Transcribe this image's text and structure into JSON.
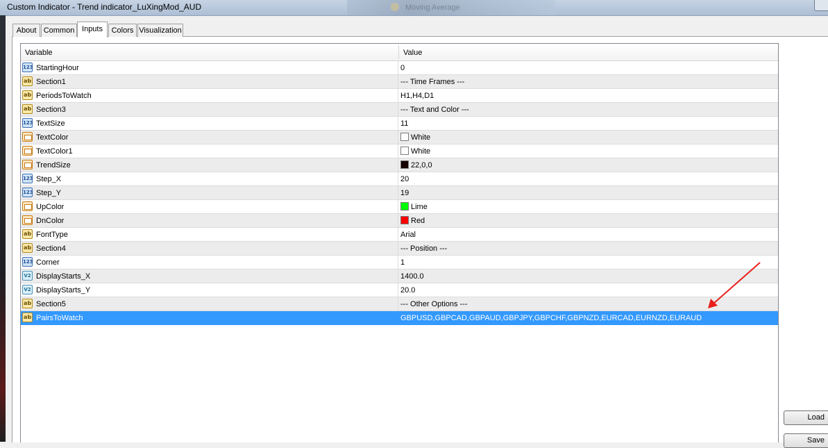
{
  "window": {
    "title": "Custom Indicator - Trend indicator_LuXingMod_AUD",
    "background_title": "Moving Average"
  },
  "tabs": [
    {
      "label": "About"
    },
    {
      "label": "Common"
    },
    {
      "label": "Inputs",
      "active": true
    },
    {
      "label": "Colors"
    },
    {
      "label": "Visualization"
    }
  ],
  "grid": {
    "header": {
      "variable": "Variable",
      "value": "Value"
    },
    "rows": [
      {
        "type": "int",
        "icon": "integer-icon",
        "name": "StartingHour",
        "value": "0"
      },
      {
        "type": "str",
        "icon": "string-icon",
        "name": "Section1",
        "value": "--- Time Frames ---"
      },
      {
        "type": "str",
        "icon": "string-icon",
        "name": "PeriodsToWatch",
        "value": "H1,H4,D1"
      },
      {
        "type": "str",
        "icon": "string-icon",
        "name": "Section3",
        "value": "--- Text and Color ---"
      },
      {
        "type": "int",
        "icon": "integer-icon",
        "name": "TextSize",
        "value": "11"
      },
      {
        "type": "col",
        "icon": "color-icon",
        "name": "TextColor",
        "value": "White",
        "swatch": "#ffffff"
      },
      {
        "type": "col",
        "icon": "color-icon",
        "name": "TextColor1",
        "value": "White",
        "swatch": "#ffffff"
      },
      {
        "type": "col",
        "icon": "color-icon",
        "name": "TrendSize",
        "value": "22,0,0",
        "swatch": "#160000"
      },
      {
        "type": "int",
        "icon": "integer-icon",
        "name": "Step_X",
        "value": "20"
      },
      {
        "type": "int",
        "icon": "integer-icon",
        "name": "Step_Y",
        "value": "19"
      },
      {
        "type": "col",
        "icon": "color-icon",
        "name": "UpColor",
        "value": "Lime",
        "swatch": "#00ff00"
      },
      {
        "type": "col",
        "icon": "color-icon",
        "name": "DnColor",
        "value": "Red",
        "swatch": "#ff0000"
      },
      {
        "type": "str",
        "icon": "string-icon",
        "name": "FontType",
        "value": "Arial"
      },
      {
        "type": "str",
        "icon": "string-icon",
        "name": "Section4",
        "value": "--- Position ---"
      },
      {
        "type": "int",
        "icon": "integer-icon",
        "name": "Corner",
        "value": "1"
      },
      {
        "type": "dbl",
        "icon": "double-icon",
        "name": "DisplayStarts_X",
        "value": "1400.0"
      },
      {
        "type": "dbl",
        "icon": "double-icon",
        "name": "DisplayStarts_Y",
        "value": "20.0"
      },
      {
        "type": "str",
        "icon": "string-icon",
        "name": "Section5",
        "value": "--- Other Options ---"
      },
      {
        "type": "str",
        "icon": "string-icon",
        "name": "PairsToWatch",
        "value": "GBPUSD,GBPCAD,GBPAUD,GBPJPY,GBPCHF,GBPNZD,EURCAD,EURNZD,EURAUD",
        "selected": true
      }
    ]
  },
  "icon_glyphs": {
    "int": "123",
    "str": "ab",
    "dbl": "V2"
  },
  "buttons": {
    "load": "Load",
    "save": "Save"
  },
  "colors": {
    "selection": "#3399ff",
    "annotation_arrow": "#e8201c",
    "alt_row": "#ececec"
  }
}
